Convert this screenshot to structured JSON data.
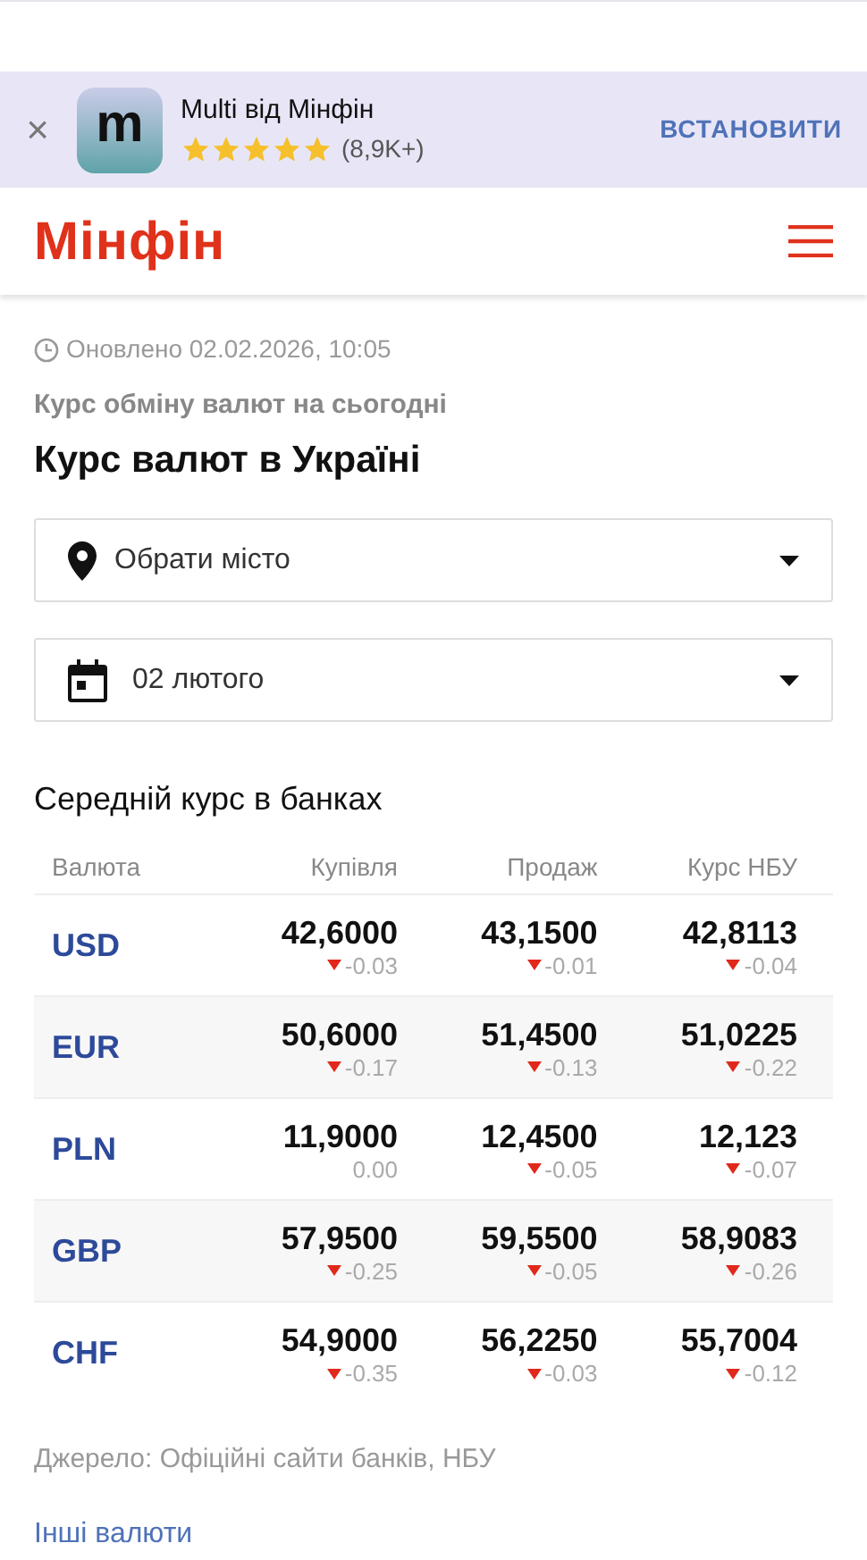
{
  "app_banner": {
    "icon_letter": "m",
    "title": "Multi від Мінфін",
    "stars": 5,
    "rating_count": "(8,9K+)",
    "install_label": "ВСТАНОВИТИ",
    "close_label": "×"
  },
  "header": {
    "logo": "Мінфін"
  },
  "updated": "Оновлено 02.02.2026, 10:05",
  "subtitle": "Курс обміну валют на сьогодні",
  "title": "Курс валют в Україні",
  "selects": [
    {
      "kind": "city",
      "value": "Обрати місто"
    },
    {
      "kind": "date",
      "value": "02 лютого"
    }
  ],
  "table": {
    "title": "Середній курс в банках",
    "columns": [
      "Валюта",
      "Купівля",
      "Продаж",
      "Курс НБУ"
    ],
    "rows": [
      {
        "cells": [
          {
            "kind": "currency",
            "value": "USD"
          },
          {
            "kind": "rate",
            "value": "42,6000",
            "change": "-0.03",
            "down": true
          },
          {
            "kind": "rate",
            "value": "43,1500",
            "change": "-0.01",
            "down": true
          },
          {
            "kind": "rate",
            "value": "42,8113",
            "change": "-0.04",
            "down": true
          }
        ]
      },
      {
        "cells": [
          {
            "kind": "currency",
            "value": "EUR"
          },
          {
            "kind": "rate",
            "value": "50,6000",
            "change": "-0.17",
            "down": true
          },
          {
            "kind": "rate",
            "value": "51,4500",
            "change": "-0.13",
            "down": true
          },
          {
            "kind": "rate",
            "value": "51,0225",
            "change": "-0.22",
            "down": true
          }
        ]
      },
      {
        "cells": [
          {
            "kind": "currency",
            "value": "PLN"
          },
          {
            "kind": "rate",
            "value": "11,9000",
            "change": "0.00",
            "down": false
          },
          {
            "kind": "rate",
            "value": "12,4500",
            "change": "-0.05",
            "down": true
          },
          {
            "kind": "rate",
            "value": "12,123",
            "change": "-0.07",
            "down": true
          }
        ]
      },
      {
        "cells": [
          {
            "kind": "currency",
            "value": "GBP"
          },
          {
            "kind": "rate",
            "value": "57,9500",
            "change": "-0.25",
            "down": true
          },
          {
            "kind": "rate",
            "value": "59,5500",
            "change": "-0.05",
            "down": true
          },
          {
            "kind": "rate",
            "value": "58,9083",
            "change": "-0.26",
            "down": true
          }
        ]
      },
      {
        "cells": [
          {
            "kind": "currency",
            "value": "CHF"
          },
          {
            "kind": "rate",
            "value": "54,9000",
            "change": "-0.35",
            "down": true
          },
          {
            "kind": "rate",
            "value": "56,2250",
            "change": "-0.03",
            "down": true
          },
          {
            "kind": "rate",
            "value": "55,7004",
            "change": "-0.12",
            "down": true
          }
        ]
      }
    ]
  },
  "source": "Джерело: Офіційні сайти банків, НБУ",
  "other_link": "Інші валюти"
}
